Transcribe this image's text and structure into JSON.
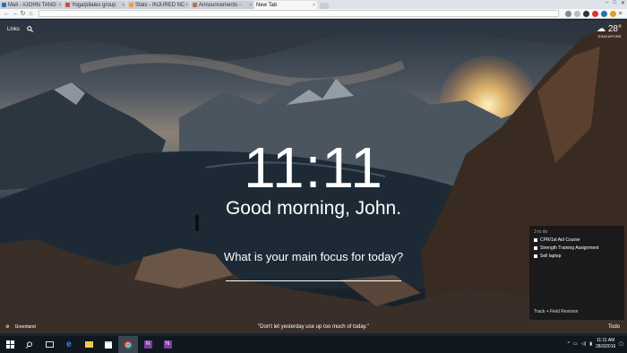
{
  "browser": {
    "tabs": [
      {
        "label": "Mail - #JOHN TANG",
        "color": "#2a6db5"
      },
      {
        "label": "Yoga/pilates group",
        "color": "#d94836"
      },
      {
        "label": "Stats - INJURED NC",
        "color": "#f0a030"
      },
      {
        "label": "Announcements -",
        "color": "#b07848"
      },
      {
        "label": "New Tab",
        "color": "#9aa0a6"
      }
    ],
    "close_glyph": "×"
  },
  "links_label": "Links",
  "weather": {
    "temp": "28°",
    "location": "SINGAPORE"
  },
  "clock": "11:11",
  "greeting": "Good morning, John.",
  "focus_question": "What is your main focus for today?",
  "todo": {
    "count": "3 to do",
    "items": [
      "CPR/1st Aid Course",
      "Strength Training Assignment",
      "Sell laptop"
    ],
    "new_item": "Track + Field Revision"
  },
  "photo_location": "Greenland",
  "quote": "\"Don't let yesterday use up too much of today.\"",
  "todo_link": "Todo",
  "taskbar": {
    "time": "11:11 AM",
    "date": "28/3/2016"
  },
  "colors": {
    "accent": "#ffffff",
    "taskbar": "#101820"
  }
}
